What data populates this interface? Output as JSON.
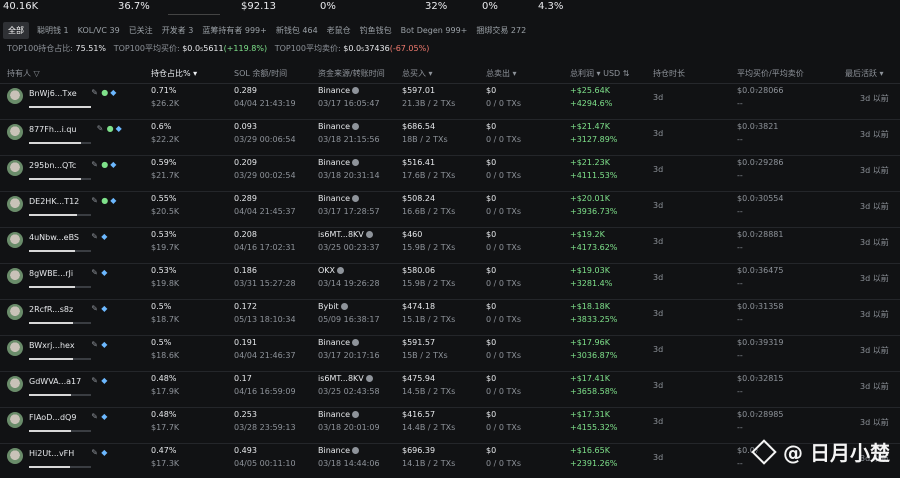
{
  "summary": [
    "40.16K",
    "36.7%",
    "$92.13",
    "0%",
    "32%",
    "0%",
    "4.3%"
  ],
  "tabs": [
    "全部",
    "聪明钱 1",
    "KOL/VC 39",
    "已关注",
    "开发者 3",
    "蓝筹持有者 999+",
    "新钱包 464",
    "老鼠仓",
    "钓鱼钱包",
    "Bot Degen 999+",
    "捆绑交易 272"
  ],
  "stats": {
    "top100_share_label": "TOP100持仓占比:",
    "top100_share": "75.51%",
    "buy_label": "TOP100平均买价:",
    "buy_price": "$0.0₅5611",
    "buy_change": "(+119.8%)",
    "sell_label": "TOP100平均卖价:",
    "sell_price": "$0.0₅37436",
    "sell_change": "(-67.05%)"
  },
  "headers": {
    "holder": "持有人",
    "share": "持仓占比%",
    "sol": "SOL 余额/时间",
    "source": "资金来源/转账时间",
    "bought": "总买入",
    "sold": "总卖出",
    "pnl": "总利润",
    "currency": "USD",
    "duration": "持仓时长",
    "avg": "平均买价/平均卖价",
    "last": "最后活跃"
  },
  "rows": [
    {
      "name": "BnWj6...Txe",
      "pct": "0.71%",
      "usd": "$26.2K",
      "sol": "0.289",
      "sol_time": "04/04 21:43:19",
      "src": "Binance",
      "src_time": "03/17 16:05:47",
      "buy": "$597.01",
      "buy_sub": "21.3B / 2 TXs",
      "sell": "$0",
      "sell_sub": "0 / 0 TXs",
      "pnl": "+$25.64K",
      "pnl_pct": "+4294.6%",
      "dur": "3d",
      "avg_buy": "$0.0₇28066",
      "avg_sell": "--",
      "last": "3d 以前",
      "user": true,
      "share": 0.71
    },
    {
      "name": "877Fh...i.qu",
      "pct": "0.6%",
      "usd": "$22.2K",
      "sol": "0.093",
      "sol_time": "03/29 00:06:54",
      "src": "Binance",
      "src_time": "03/18 21:15:56",
      "buy": "$686.54",
      "buy_sub": "18B / 2 TXs",
      "sell": "$0",
      "sell_sub": "0 / 0 TXs",
      "pnl": "+$21.47K",
      "pnl_pct": "+3127.89%",
      "dur": "3d",
      "avg_buy": "$0.0₇3821",
      "avg_sell": "--",
      "last": "3d 以前",
      "user": true,
      "share": 0.6
    },
    {
      "name": "295bn...QTc",
      "pct": "0.59%",
      "usd": "$21.7K",
      "sol": "0.209",
      "sol_time": "03/29 00:02:54",
      "src": "Binance",
      "src_time": "03/18 20:31:14",
      "buy": "$516.41",
      "buy_sub": "17.6B / 2 TXs",
      "sell": "$0",
      "sell_sub": "0 / 0 TXs",
      "pnl": "+$21.23K",
      "pnl_pct": "+4111.53%",
      "dur": "3d",
      "avg_buy": "$0.0₇29286",
      "avg_sell": "--",
      "last": "3d 以前",
      "user": true,
      "share": 0.59
    },
    {
      "name": "DE2HK...T12",
      "pct": "0.55%",
      "usd": "$20.5K",
      "sol": "0.289",
      "sol_time": "04/04 21:45:37",
      "src": "Binance",
      "src_time": "03/17 17:28:57",
      "buy": "$508.24",
      "buy_sub": "16.6B / 2 TXs",
      "sell": "$0",
      "sell_sub": "0 / 0 TXs",
      "pnl": "+$20.01K",
      "pnl_pct": "+3936.73%",
      "dur": "3d",
      "avg_buy": "$0.0₇30554",
      "avg_sell": "--",
      "last": "3d 以前",
      "user": true,
      "share": 0.55
    },
    {
      "name": "4uNbw...eBS",
      "pct": "0.53%",
      "usd": "$19.7K",
      "sol": "0.208",
      "sol_time": "04/16 17:02:31",
      "src": "is6MT...8KV",
      "src_time": "03/25 00:23:37",
      "buy": "$460",
      "buy_sub": "15.9B / 2 TXs",
      "sell": "$0",
      "sell_sub": "0 / 0 TXs",
      "pnl": "+$19.2K",
      "pnl_pct": "+4173.62%",
      "dur": "3d",
      "avg_buy": "$0.0₇28881",
      "avg_sell": "--",
      "last": "3d 以前",
      "user": false,
      "share": 0.53
    },
    {
      "name": "8gWBE...rJi",
      "pct": "0.53%",
      "usd": "$19.8K",
      "sol": "0.186",
      "sol_time": "03/31 15:27:28",
      "src": "OKX",
      "src_time": "03/14 19:26:28",
      "buy": "$580.06",
      "buy_sub": "15.9B / 2 TXs",
      "sell": "$0",
      "sell_sub": "0 / 0 TXs",
      "pnl": "+$19.03K",
      "pnl_pct": "+3281.4%",
      "dur": "3d",
      "avg_buy": "$0.0₇36475",
      "avg_sell": "--",
      "last": "3d 以前",
      "user": false,
      "share": 0.53
    },
    {
      "name": "2RcfR...s8z",
      "pct": "0.5%",
      "usd": "$18.7K",
      "sol": "0.172",
      "sol_time": "05/13 18:10:34",
      "src": "Bybit",
      "src_time": "05/09 16:38:17",
      "buy": "$474.18",
      "buy_sub": "15.1B / 2 TXs",
      "sell": "$0",
      "sell_sub": "0 / 0 TXs",
      "pnl": "+$18.18K",
      "pnl_pct": "+3833.25%",
      "dur": "3d",
      "avg_buy": "$0.0₇31358",
      "avg_sell": "--",
      "last": "3d 以前",
      "user": false,
      "share": 0.5
    },
    {
      "name": "BWxrj...hex",
      "pct": "0.5%",
      "usd": "$18.6K",
      "sol": "0.191",
      "sol_time": "04/04 21:46:37",
      "src": "Binance",
      "src_time": "03/17 20:17:16",
      "buy": "$591.57",
      "buy_sub": "15B / 2 TXs",
      "sell": "$0",
      "sell_sub": "0 / 0 TXs",
      "pnl": "+$17.96K",
      "pnl_pct": "+3036.87%",
      "dur": "3d",
      "avg_buy": "$0.0₇39319",
      "avg_sell": "--",
      "last": "3d 以前",
      "user": false,
      "share": 0.5
    },
    {
      "name": "GdWVA...a17",
      "pct": "0.48%",
      "usd": "$17.9K",
      "sol": "0.17",
      "sol_time": "04/16 16:59:09",
      "src": "is6MT...8KV",
      "src_time": "03/25 02:43:58",
      "buy": "$475.94",
      "buy_sub": "14.5B / 2 TXs",
      "sell": "$0",
      "sell_sub": "0 / 0 TXs",
      "pnl": "+$17.41K",
      "pnl_pct": "+3658.58%",
      "dur": "3d",
      "avg_buy": "$0.0₇32815",
      "avg_sell": "--",
      "last": "3d 以前",
      "user": false,
      "share": 0.48
    },
    {
      "name": "FIAoD...dQ9",
      "pct": "0.48%",
      "usd": "$17.7K",
      "sol": "0.253",
      "sol_time": "03/28 23:59:13",
      "src": "Binance",
      "src_time": "03/18 20:01:09",
      "buy": "$416.57",
      "buy_sub": "14.4B / 2 TXs",
      "sell": "$0",
      "sell_sub": "0 / 0 TXs",
      "pnl": "+$17.31K",
      "pnl_pct": "+4155.32%",
      "dur": "3d",
      "avg_buy": "$0.0₇28985",
      "avg_sell": "--",
      "last": "3d 以前",
      "user": false,
      "share": 0.48
    },
    {
      "name": "Hi2Ut...vFH",
      "pct": "0.47%",
      "usd": "$17.3K",
      "sol": "0.493",
      "sol_time": "04/05 00:11:10",
      "src": "Binance",
      "src_time": "03/18 14:44:06",
      "buy": "$696.39",
      "buy_sub": "14.1B / 2 TXs",
      "sell": "$0",
      "sell_sub": "0 / 0 TXs",
      "pnl": "+$16.65K",
      "pnl_pct": "+2391.26%",
      "dur": "3d",
      "avg_buy": "$0.0₇",
      "avg_sell": "--",
      "last": "3d 以前",
      "user": false,
      "share": 0.47
    }
  ],
  "watermark": "@ 日月小楚"
}
